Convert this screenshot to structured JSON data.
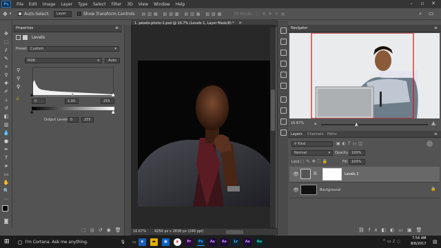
{
  "menu": [
    "File",
    "Edit",
    "Image",
    "Layer",
    "Type",
    "Select",
    "Filter",
    "3D",
    "View",
    "Window",
    "Help"
  ],
  "app_logo": "Ps",
  "options": {
    "auto_select_label": "Auto-Select:",
    "auto_select_value": "Layer",
    "show_transform": "Show Transform Controls",
    "mode_3d": "3D Mode:"
  },
  "properties": {
    "tab": "Properties",
    "panel_title": "Levels",
    "preset_label": "Preset:",
    "preset_value": "Custom",
    "channel": "RGB",
    "auto_button": "Auto",
    "input_black": "0",
    "input_gamma": "1.00",
    "input_white": "255",
    "output_label": "Output Levels:",
    "output_black": "0",
    "output_white": "255"
  },
  "document": {
    "tab_title": "1. pexels-photo-1.psd @ 16.7% (Levels 1, Layer Mask/8) *",
    "zoom": "16.67%",
    "doc_info": "4256 px x 2838 px (240 ppi)"
  },
  "navigator": {
    "tab": "Navigator",
    "zoom": "16.67%"
  },
  "layers": {
    "tabs": [
      "Layers",
      "Channels",
      "Paths"
    ],
    "kind_label": "Kind",
    "blend_mode": "Normal",
    "opacity_label": "Opacity:",
    "opacity_value": "100%",
    "lock_label": "Lock:",
    "fill_label": "Fill:",
    "fill_value": "100%",
    "items": [
      {
        "name": "Levels 1"
      },
      {
        "name": "Background"
      }
    ]
  },
  "taskbar": {
    "search_placeholder": "I'm Cortana. Ask me anything.",
    "apps": [
      {
        "label": "Pr",
        "color": "#2a0a3d",
        "fg": "#e59bff"
      },
      {
        "label": "Ps",
        "color": "#0a2a45",
        "fg": "#3ea6ff"
      },
      {
        "label": "Ae",
        "color": "#1d0a3d",
        "fg": "#d38bff"
      },
      {
        "label": "Ae",
        "color": "#1d0a3d",
        "fg": "#d38bff"
      },
      {
        "label": "Lr",
        "color": "#0a2535",
        "fg": "#62c3ff"
      },
      {
        "label": "Ae",
        "color": "#1d0a3d",
        "fg": "#d38bff"
      },
      {
        "label": "Au",
        "color": "#002a2a",
        "fg": "#3fe0c8"
      }
    ],
    "time": "7:54 AM",
    "date": "8/6/2017"
  },
  "colors": {
    "accent": "#3ea6ff",
    "panel": "#535353",
    "taskbar": "#1c1c1c"
  }
}
